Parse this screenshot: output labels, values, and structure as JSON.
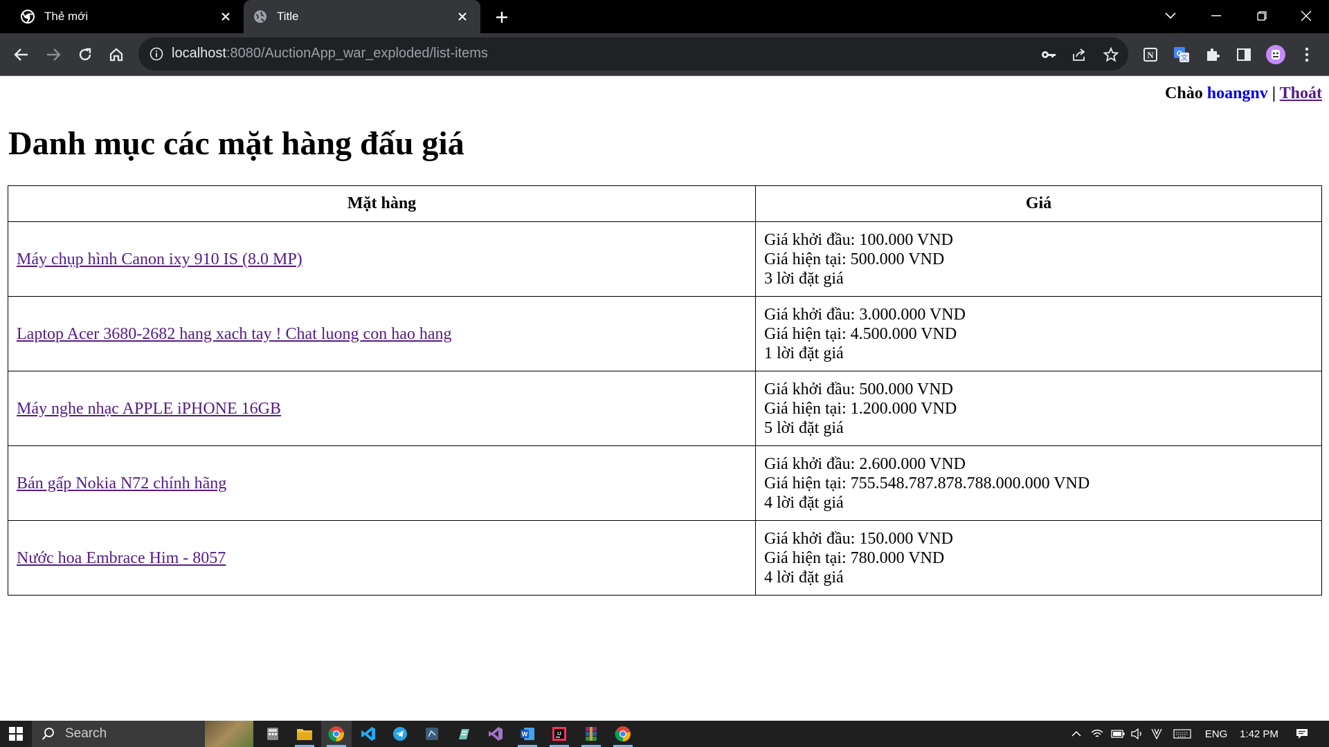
{
  "browser": {
    "tabs": [
      {
        "title": "Thẻ mới",
        "favicon": "chrome-icon"
      },
      {
        "title": "Title",
        "favicon": "globe-icon"
      }
    ],
    "url_host": "localhost",
    "url_rest": ":8080/AuctionApp_war_exploded/list-items"
  },
  "header": {
    "greeting_prefix": "Chào",
    "username": "hoangnv",
    "separator": "|",
    "logout_label": "Thoát"
  },
  "page": {
    "title": "Danh mục các mặt hàng đấu giá"
  },
  "table": {
    "headers": [
      "Mặt hàng",
      "Giá"
    ],
    "rows": [
      {
        "name": "Máy chụp hình Canon ixy 910 IS (8.0 MP)",
        "start": "Giá khởi đầu: 100.000 VND",
        "current": "Giá hiện tại: 500.000 VND",
        "bids": "3 lời đặt giá"
      },
      {
        "name": "Laptop Acer 3680-2682 hang xach tay ! Chat luong con hao hang",
        "start": "Giá khởi đầu: 3.000.000 VND",
        "current": "Giá hiện tại: 4.500.000 VND",
        "bids": "1 lời đặt giá"
      },
      {
        "name": "Máy nghe nhạc APPLE iPHONE 16GB",
        "start": "Giá khởi đầu: 500.000 VND",
        "current": "Giá hiện tại: 1.200.000 VND",
        "bids": "5 lời đặt giá"
      },
      {
        "name": "Bán gấp Nokia N72 chính hãng",
        "start": "Giá khởi đầu: 2.600.000 VND",
        "current": "Giá hiện tại: 755.548.787.878.788.000.000 VND",
        "bids": "4 lời đặt giá"
      },
      {
        "name": "Nước hoa Embrace Him - 8057",
        "start": "Giá khởi đầu: 150.000 VND",
        "current": "Giá hiện tại: 780.000 VND",
        "bids": "4 lời đặt giá"
      }
    ]
  },
  "taskbar": {
    "search_placeholder": "Search",
    "language": "ENG",
    "time": "1:42 PM"
  },
  "colors": {
    "link_visited": "#551a8b",
    "link_user": "#0000ee",
    "chrome_dark": "#35363a"
  }
}
